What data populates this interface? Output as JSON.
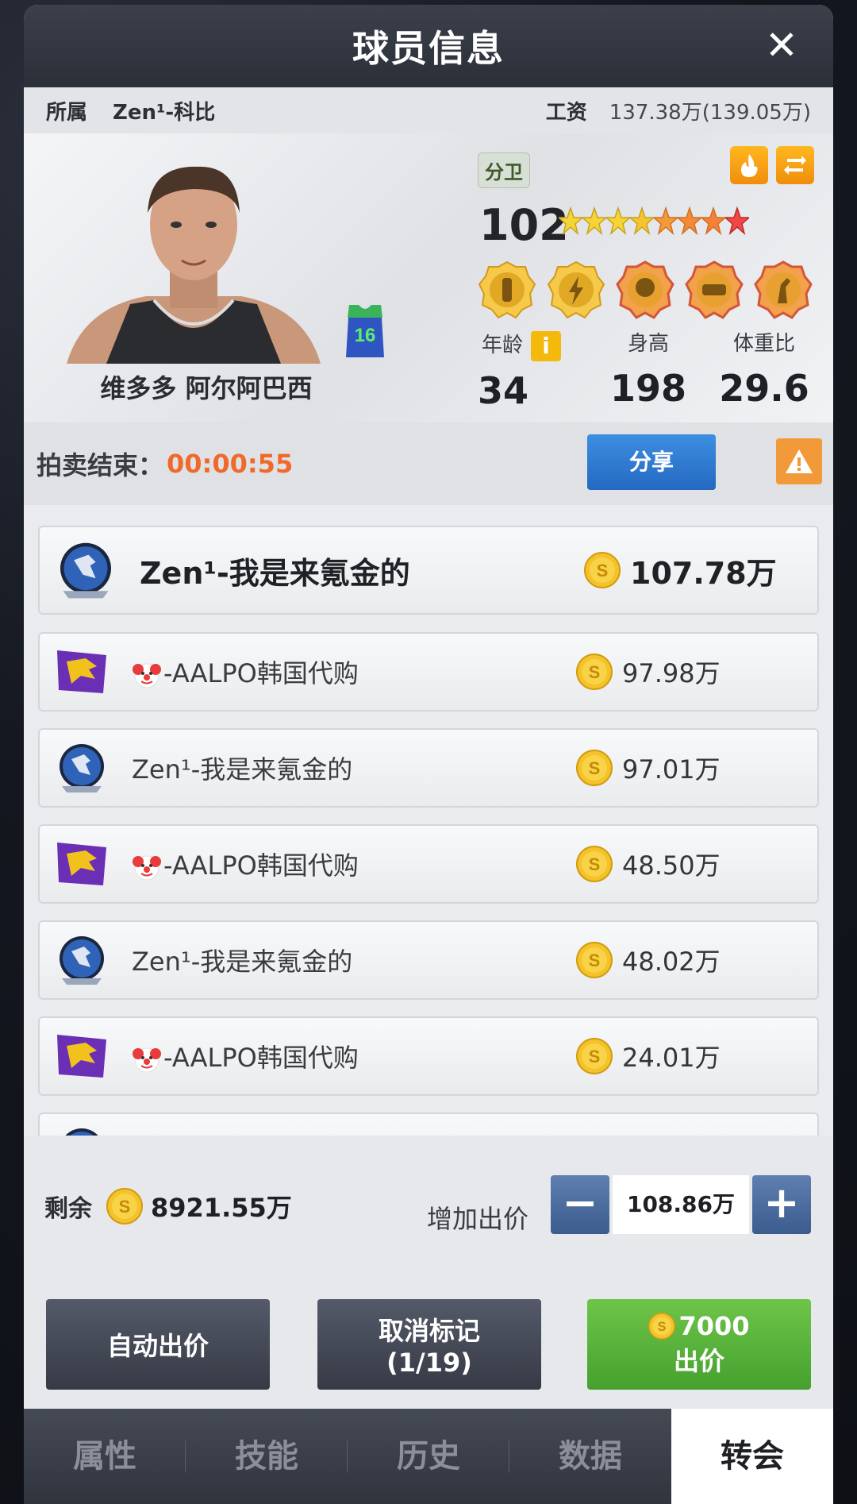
{
  "window": {
    "title": "球员信息"
  },
  "info": {
    "team_label": "所属",
    "team_value": "Zen¹-科比",
    "salary_label": "工资",
    "salary_value": "137.38万(139.05万)"
  },
  "player": {
    "name": "维多多 阿尔阿巴西",
    "position": "分卫",
    "jersey_number": "16",
    "rating": "102",
    "stars_total": 8,
    "age_label": "年龄",
    "age": "34",
    "height_label": "身高",
    "height": "198",
    "weight_label": "体重比",
    "weight": "29.6",
    "badges": [
      "post-badge-icon",
      "lightning-badge-icon",
      "defense-badge-icon",
      "pass-badge-icon",
      "shoot-badge-icon"
    ]
  },
  "auction": {
    "end_label": "拍卖结束：",
    "timer": "00:00:55",
    "share_label": "分享"
  },
  "bids": [
    {
      "team": "Zen¹-我是来氪金的",
      "amount": "107.78万",
      "logo": "eagle-logo-icon"
    },
    {
      "team": "-AALPO韩国代购",
      "amount": "97.98万",
      "logo": "dragon-logo-icon"
    },
    {
      "team": "Zen¹-我是来氪金的",
      "amount": "97.01万",
      "logo": "eagle-logo-icon"
    },
    {
      "team": "-AALPO韩国代购",
      "amount": "48.50万",
      "logo": "dragon-logo-icon"
    },
    {
      "team": "Zen¹-我是来氪金的",
      "amount": "48.02万",
      "logo": "eagle-logo-icon"
    },
    {
      "team": "-AALPO韩国代购",
      "amount": "24.01万",
      "logo": "dragon-logo-icon"
    }
  ],
  "controls": {
    "remain_label": "剩余",
    "remain_value": "8921.55万",
    "raise_label": "增加出价",
    "raise_value": "108.86万",
    "auto_bid_label": "自动出价",
    "cancel_mark_label": "取消标记",
    "cancel_mark_count": "(1/19)",
    "bid_cost": "7000",
    "bid_label": "出价"
  },
  "tabs": [
    "属性",
    "技能",
    "历史",
    "数据",
    "转会"
  ],
  "colors": {
    "accent_orange": "#f0692a",
    "share_blue": "#2f7bd3",
    "bid_green": "#56b139"
  }
}
